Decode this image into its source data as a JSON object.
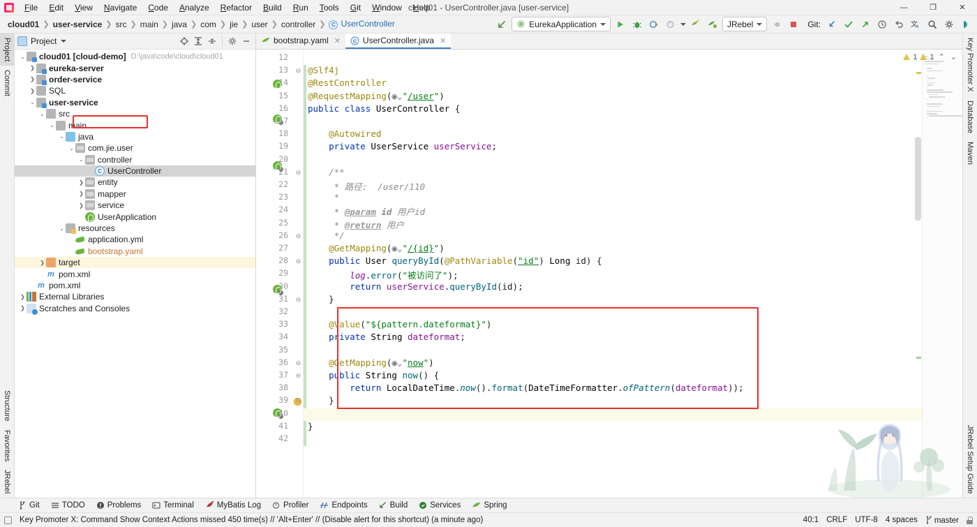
{
  "window": {
    "title": "cloud01 - UserController.java [user-service]",
    "controls": {
      "minimize": "—",
      "maximize": "❐",
      "close": "✕"
    }
  },
  "menu": [
    "File",
    "Edit",
    "View",
    "Navigate",
    "Code",
    "Analyze",
    "Refactor",
    "Build",
    "Run",
    "Tools",
    "Git",
    "Window",
    "Help"
  ],
  "breadcrumb": [
    {
      "label": "cloud01",
      "bold": true
    },
    {
      "label": "user-service",
      "bold": true
    },
    {
      "label": "src",
      "bold": false
    },
    {
      "label": "main",
      "bold": false
    },
    {
      "label": "java",
      "bold": false
    },
    {
      "label": "com",
      "bold": false
    },
    {
      "label": "jie",
      "bold": false
    },
    {
      "label": "user",
      "bold": false
    },
    {
      "label": "controller",
      "bold": false
    },
    {
      "label": "UserController",
      "bold": false,
      "link": true,
      "badge": "C"
    }
  ],
  "toolbar": {
    "back_arrow_icon": "arrow-up-left-icon",
    "run_config": "EurekaApplication",
    "run_button": "run-icon",
    "debug_button": "debug-icon",
    "run_coverage_button": "run-with-coverage-icon",
    "profile_button": "profiler-icon",
    "jrebel_run": "jrebel-run-icon",
    "jrebel_debug": "jrebel-debug-icon",
    "jrebel_label": "JRebel",
    "stop_button": "stop-icon",
    "stop_red_button": "stop-red-icon",
    "git_label": "Git:",
    "git_update": "update-project-icon",
    "git_commit": "commit-icon",
    "git_push": "push-icon",
    "git_history": "history-icon",
    "git_rollback": "rollback-icon",
    "search_everywhere": "search-icon",
    "settings": "gear-icon",
    "translate": "translate-icon",
    "ide_widget": "ide-icon"
  },
  "left_strip": [
    "Project",
    "Commit",
    "Structure",
    "Favorites",
    "JRebel"
  ],
  "right_strip": [
    "Key Promoter X",
    "Database",
    "Maven",
    "JRebel Setup Guide"
  ],
  "project_panel": {
    "title": "Project",
    "tools": [
      "locate-icon",
      "expand-all-icon",
      "collapse-all-icon",
      "settings-icon",
      "hide-icon"
    ],
    "tree": [
      {
        "depth": 0,
        "arrow": "down",
        "icon": "module",
        "label": "cloud01 [cloud-demo]",
        "bold": true,
        "path": "D:\\java\\code\\cloud\\cloud01"
      },
      {
        "depth": 1,
        "arrow": "right",
        "icon": "module",
        "label": "eureka-server",
        "bold": true
      },
      {
        "depth": 1,
        "arrow": "right",
        "icon": "module",
        "label": "order-service",
        "bold": true
      },
      {
        "depth": 1,
        "arrow": "right",
        "icon": "folder",
        "label": "SQL",
        "bold": false
      },
      {
        "depth": 1,
        "arrow": "down",
        "icon": "module",
        "label": "user-service",
        "bold": true
      },
      {
        "depth": 2,
        "arrow": "down",
        "icon": "folder",
        "label": "src",
        "bold": false
      },
      {
        "depth": 3,
        "arrow": "down",
        "icon": "folder",
        "label": "main",
        "bold": false
      },
      {
        "depth": 4,
        "arrow": "down",
        "icon": "source",
        "label": "java",
        "bold": false
      },
      {
        "depth": 5,
        "arrow": "down",
        "icon": "package",
        "label": "com.jie.user",
        "bold": false
      },
      {
        "depth": 6,
        "arrow": "down",
        "icon": "package",
        "label": "controller",
        "bold": false
      },
      {
        "depth": 7,
        "arrow": "none",
        "icon": "class",
        "label": "UserController",
        "bold": false,
        "selected": true,
        "boxed": true
      },
      {
        "depth": 6,
        "arrow": "right",
        "icon": "package",
        "label": "entity",
        "bold": false
      },
      {
        "depth": 6,
        "arrow": "right",
        "icon": "package",
        "label": "mapper",
        "bold": false
      },
      {
        "depth": 6,
        "arrow": "right",
        "icon": "package",
        "label": "service",
        "bold": false
      },
      {
        "depth": 6,
        "arrow": "none",
        "icon": "spring",
        "label": "UserApplication",
        "bold": false
      },
      {
        "depth": 4,
        "arrow": "down",
        "icon": "resource",
        "label": "resources",
        "bold": false
      },
      {
        "depth": 5,
        "arrow": "none",
        "icon": "yaml",
        "label": "application.yml",
        "bold": false
      },
      {
        "depth": 5,
        "arrow": "none",
        "icon": "yaml",
        "label": "bootstrap.yaml",
        "bold": false,
        "orange": true
      },
      {
        "depth": 2,
        "arrow": "right",
        "icon": "target",
        "label": "target",
        "bold": false,
        "highlight": true
      },
      {
        "depth": 2,
        "arrow": "none",
        "icon": "maven",
        "label": "pom.xml",
        "bold": false
      },
      {
        "depth": 1,
        "arrow": "none",
        "icon": "maven",
        "label": "pom.xml",
        "bold": false
      },
      {
        "depth": 0,
        "arrow": "right",
        "icon": "library",
        "label": "External Libraries",
        "bold": false
      },
      {
        "depth": 0,
        "arrow": "right",
        "icon": "scratch",
        "label": "Scratches and Consoles",
        "bold": false
      }
    ]
  },
  "editor": {
    "tabs": [
      {
        "label": "bootstrap.yaml",
        "icon": "yaml-icon",
        "active": false
      },
      {
        "label": "UserController.java",
        "icon": "class-icon",
        "active": true
      }
    ],
    "inspections": {
      "warnings1": "1",
      "warnings2": "1",
      "prev": "⌃",
      "next": "⌄"
    },
    "first_line": 12,
    "lines": [
      {
        "n": 12,
        "html": ""
      },
      {
        "n": 13,
        "html": "<span class='ann'>@Slf4j</span>"
      },
      {
        "n": 14,
        "html": "<span class='ann'>@RestController</span>",
        "gutter": "bean"
      },
      {
        "n": 15,
        "html": "<span class='ann'>@RequestMapping</span>(<span class='globe'>&#9673;&#8964;</span><span class='str'>\"</span><span class='str und'>/user</span><span class='str'>\"</span>)"
      },
      {
        "n": 16,
        "html": "<span class='kw'>public</span> <span class='kw'>class</span> <span class='typ'>UserController</span> {",
        "gutter": "bean-ovr"
      },
      {
        "n": 17,
        "html": ""
      },
      {
        "n": 18,
        "html": "    <span class='ann'>@Autowired</span>"
      },
      {
        "n": 19,
        "html": "    <span class='kw'>private</span> <span class='typ'>UserService</span> <span class='fld'>userService</span>;",
        "gutter": "bean-ovr"
      },
      {
        "n": 20,
        "html": ""
      },
      {
        "n": 21,
        "html": "    <span class='cmt'>/**</span>"
      },
      {
        "n": 22,
        "html": "     <span class='cmt'>* 路径:  /user/110</span>"
      },
      {
        "n": 23,
        "html": "     <span class='cmt'>*</span>"
      },
      {
        "n": 24,
        "html": "     <span class='cmt'>* <span class='tag'>@param</span> <b>id</b> 用户id</span>"
      },
      {
        "n": 25,
        "html": "     <span class='cmt'>* <span class='tag'>@return</span> 用户</span>"
      },
      {
        "n": 26,
        "html": "     <span class='cmt'>*/</span>"
      },
      {
        "n": 27,
        "html": "    <span class='ann'>@GetMapping</span>(<span class='globe'>&#9673;&#8964;</span><span class='str'>\"</span><span class='str und'>/{id}</span><span class='str'>\"</span>)"
      },
      {
        "n": 28,
        "html": "    <span class='kw'>public</span> <span class='typ'>User</span> <span class='mth'>queryById</span>(<span class='ann'>@PathVariable</span>(<span class='str und'>\"id\"</span>) <span class='typ'>Long</span> id) {",
        "gutter": "bean-ovr"
      },
      {
        "n": 29,
        "html": "        <span class='fld ital'>log</span>.<span class='mth'>error</span>(<span class='str'>\"被访问了\"</span>);"
      },
      {
        "n": 30,
        "html": "        <span class='kw'>return</span> <span class='fld'>userService</span>.<span class='mth'>queryById</span>(id);"
      },
      {
        "n": 31,
        "html": "    }"
      },
      {
        "n": 32,
        "html": ""
      },
      {
        "n": 33,
        "html": "    <span class='ann'>@Value</span>(<span class='str'>\"${pattern.dateformat}\"</span>)"
      },
      {
        "n": 34,
        "html": "    <span class='kw'>private</span> <span class='typ'>String</span> <span class='fld'>dateformat</span>;"
      },
      {
        "n": 35,
        "html": ""
      },
      {
        "n": 36,
        "html": "    <span class='ann'>@GetMapping</span>(<span class='globe'>&#9673;&#8964;</span><span class='str'>\"</span><span class='str und'>now</span><span class='str'>\"</span>)"
      },
      {
        "n": 37,
        "html": "    <span class='kw'>public</span> <span class='typ'>String</span> <span class='mth'>now</span>() {",
        "gutter": "bean-ovr"
      },
      {
        "n": 38,
        "html": "        <span class='kw'>return</span> <span class='typ'>LocalDateTime</span>.<span class='mth ital'>now</span>().<span class='mth'>format</span>(<span class='typ'>DateTimeFormatter</span>.<span class='mth ital'>ofPattern</span>(<span class='fld'>dateformat</span>));"
      },
      {
        "n": 39,
        "html": "    }",
        "bulb": true
      },
      {
        "n": 40,
        "html": "",
        "current": true
      },
      {
        "n": 41,
        "html": "}"
      },
      {
        "n": 42,
        "html": ""
      }
    ]
  },
  "bottom_bar": [
    {
      "label": "Git",
      "icon": "git-icon"
    },
    {
      "label": "TODO",
      "icon": "todo-icon"
    },
    {
      "label": "Problems",
      "icon": "problems-icon"
    },
    {
      "label": "Terminal",
      "icon": "terminal-icon"
    },
    {
      "label": "MyBatis Log",
      "icon": "mybatis-icon"
    },
    {
      "label": "Profiler",
      "icon": "profiler-icon"
    },
    {
      "label": "Endpoints",
      "icon": "endpoints-icon"
    },
    {
      "label": "Build",
      "icon": "build-icon"
    },
    {
      "label": "Services",
      "icon": "services-icon"
    },
    {
      "label": "Spring",
      "icon": "spring-icon"
    }
  ],
  "status_bar": {
    "message": "Key Promoter X: Command Show Context Actions missed 450 time(s) // 'Alt+Enter' // (Disable alert for this shortcut) (a minute ago)",
    "caret": "40:1",
    "line_sep": "CRLF",
    "encoding": "UTF-8",
    "indent": "4 spaces",
    "branch": "master",
    "lock_icon": "lock-icon"
  }
}
